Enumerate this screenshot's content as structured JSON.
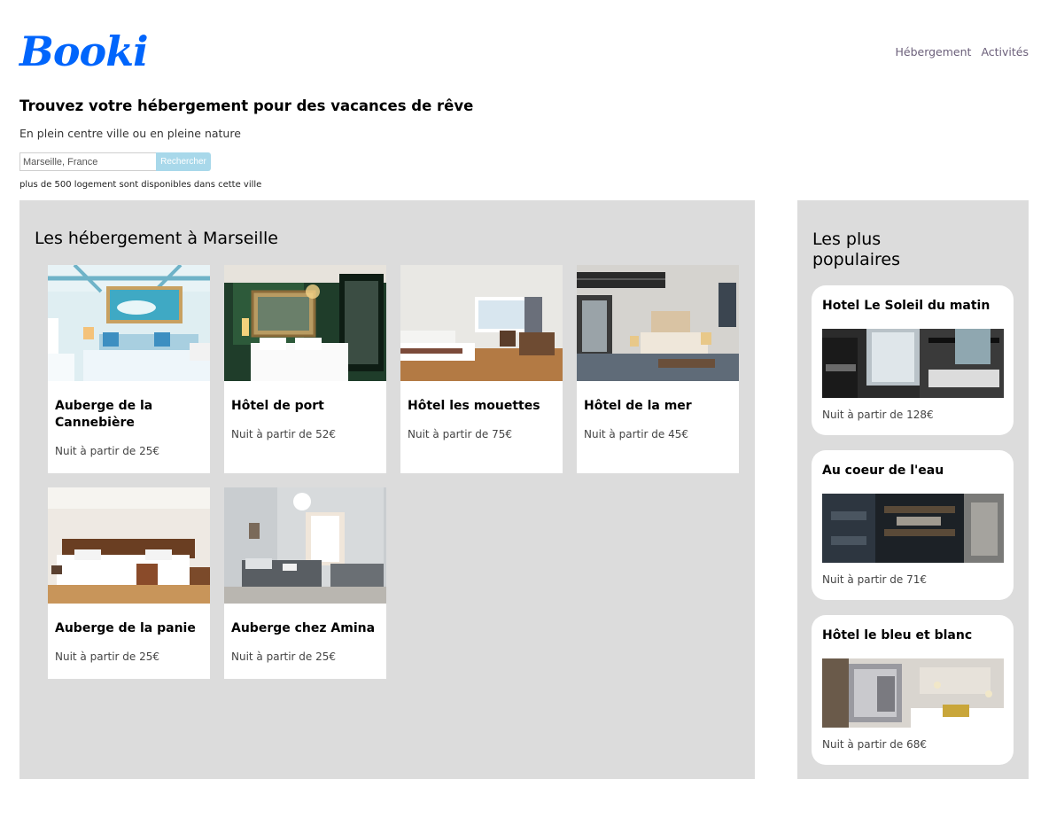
{
  "brand": {
    "logo_text": "Booki",
    "logo_color": "#0065fc"
  },
  "nav": {
    "items": [
      "Hébergement",
      "Activités"
    ]
  },
  "hero": {
    "title": "Trouvez votre hébergement pour des vacances de rêve",
    "subtitle": "En plein centre ville ou en pleine nature"
  },
  "search": {
    "placeholder": "Marseille, France",
    "button_label": "Rechercher",
    "info": "plus de 500 logement sont disponibles dans cette ville"
  },
  "lodging": {
    "title": "Les hébergement à Marseille",
    "cards": [
      {
        "name": "Auberge de la Cannebière",
        "price": "Nuit à partir de 25€"
      },
      {
        "name": "Hôtel de port",
        "price": "Nuit à partir de 52€"
      },
      {
        "name": "Hôtel les mouettes",
        "price": "Nuit à partir de 75€"
      },
      {
        "name": "Hôtel de la mer",
        "price": "Nuit à partir de 45€"
      },
      {
        "name": "Auberge de la panie",
        "price": "Nuit à partir de 25€"
      },
      {
        "name": "Auberge chez Amina",
        "price": "Nuit à partir de 25€"
      }
    ]
  },
  "popular": {
    "title": "Les plus populaires",
    "cards": [
      {
        "name": "Hotel Le Soleil du matin",
        "price": "Nuit à partir de 128€"
      },
      {
        "name": "Au coeur de l'eau",
        "price": "Nuit à partir de 71€"
      },
      {
        "name": "Hôtel le bleu et blanc",
        "price": "Nuit à partir de 68€"
      }
    ]
  },
  "colors": {
    "panel_bg": "#dcdcdc",
    "search_button": "#a8d8ea",
    "nav_text": "#6b5f7a"
  }
}
